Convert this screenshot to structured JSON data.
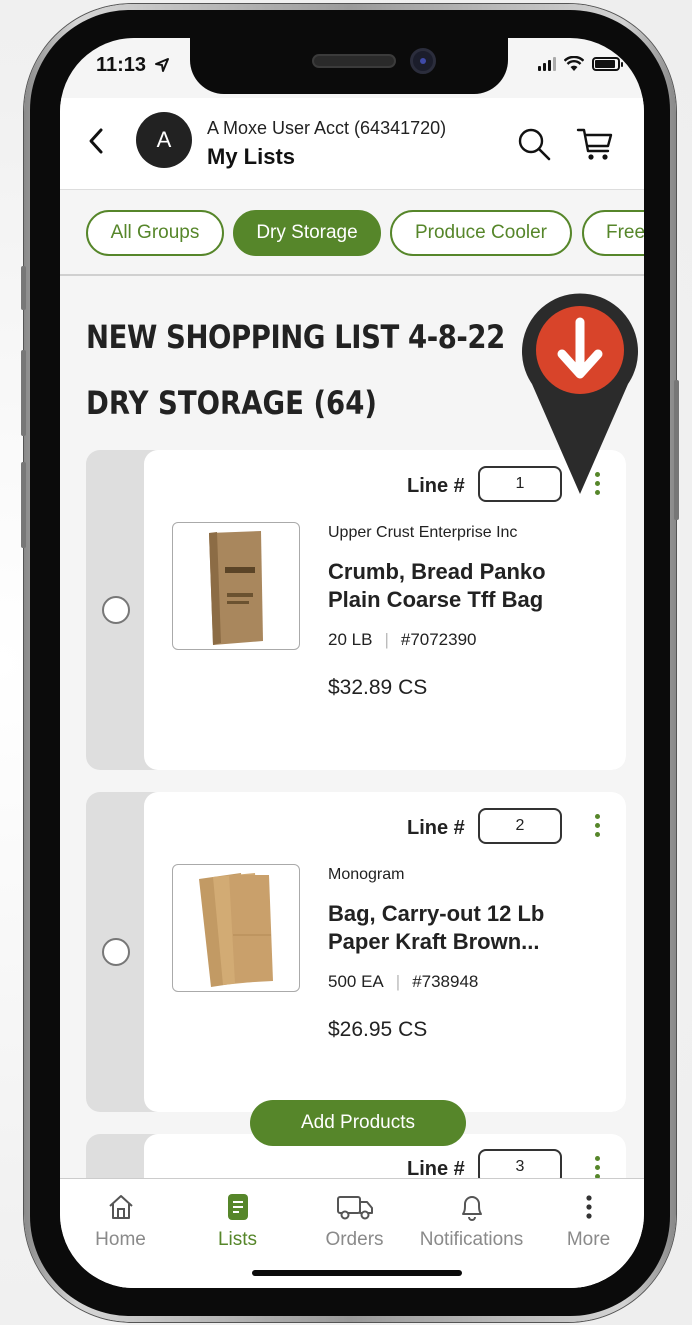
{
  "status_bar": {
    "time": "11:13"
  },
  "header": {
    "account_name": "A Moxe User Acct (64341720)",
    "avatar_initial": "A",
    "title": "My Lists"
  },
  "tabs": [
    {
      "label": "All Groups",
      "active": false
    },
    {
      "label": "Dry Storage",
      "active": true
    },
    {
      "label": "Produce Cooler",
      "active": false
    },
    {
      "label": "Free",
      "active": false
    }
  ],
  "list": {
    "title": "NEW SHOPPING LIST 4-8-22",
    "group_title": "DRY STORAGE (64)"
  },
  "products": [
    {
      "line_label": "Line #",
      "line_number": "1",
      "brand": "Upper Crust Enterprise Inc",
      "name_line1": "Crumb, Bread Panko",
      "name_line2": "Plain Coarse Tff Bag",
      "pack": "20 LB",
      "item_number": "#7072390",
      "price": "$32.89 CS"
    },
    {
      "line_label": "Line #",
      "line_number": "2",
      "brand": "Monogram",
      "name_line1": "Bag, Carry-out 12 Lb",
      "name_line2": "Paper Kraft Brown...",
      "pack": "500 EA",
      "item_number": "#738948",
      "price": "$26.95 CS"
    },
    {
      "line_label": "Line #",
      "line_number": "3"
    }
  ],
  "add_products_label": "Add Products",
  "bottom_nav": [
    {
      "label": "Home",
      "icon": "home-icon",
      "active": false
    },
    {
      "label": "Lists",
      "icon": "list-icon",
      "active": true
    },
    {
      "label": "Orders",
      "icon": "truck-icon",
      "active": false
    },
    {
      "label": "Notifications",
      "icon": "bell-icon",
      "active": false
    },
    {
      "label": "More",
      "icon": "more-icon",
      "active": false
    }
  ],
  "colors": {
    "brand_green": "#56862a",
    "pin_red": "#d8442a"
  }
}
